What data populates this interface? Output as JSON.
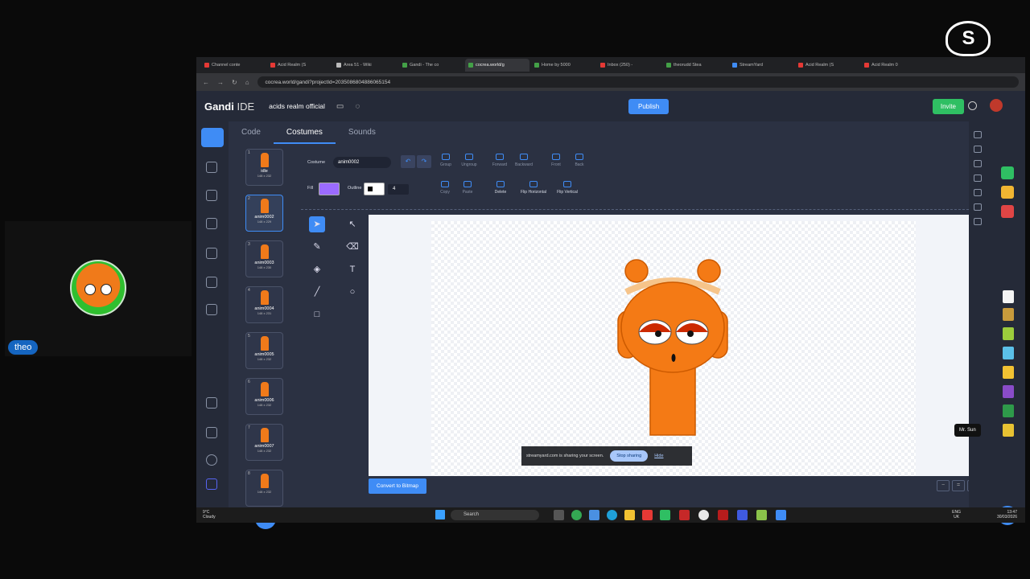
{
  "participant": {
    "name": "theo"
  },
  "brand": {
    "logo": "S",
    "name": "streamyard"
  },
  "browser": {
    "tabs": [
      {
        "title": "Channel conte",
        "color": "#e53935"
      },
      {
        "title": "Acid Realm (S",
        "color": "#e53935"
      },
      {
        "title": "Area 51 - Wiki",
        "color": "#bbbbbb"
      },
      {
        "title": "Gandi - The co",
        "color": "#43a047"
      },
      {
        "title": "cocrea.world/g",
        "color": "#43a047"
      },
      {
        "title": "Home by 5000",
        "color": "#43a047"
      },
      {
        "title": "Inbox (250) -",
        "color": "#e53935"
      },
      {
        "title": "theorudd Stea",
        "color": "#43a047"
      },
      {
        "title": "StreamYard",
        "color": "#3f8cf5"
      },
      {
        "title": "Acid Realm (S",
        "color": "#e53935"
      },
      {
        "title": "Acid Realm 0",
        "color": "#e53935"
      }
    ],
    "url": "cocrea.world/gandi?projectId=2035086804886065154"
  },
  "ide": {
    "logo": "Gandi",
    "logo_suffix": "IDE",
    "project_name": "acids realm official",
    "publish": "Publish",
    "invite": "Invite",
    "tabs": [
      {
        "label": "Code",
        "active": false
      },
      {
        "label": "Costumes",
        "active": true
      },
      {
        "label": "Sounds",
        "active": false
      }
    ],
    "costumes": [
      {
        "num": "1",
        "name": "idle",
        "size": "148 x 232"
      },
      {
        "num": "2",
        "name": "anim0002",
        "size": "148 x 229"
      },
      {
        "num": "3",
        "name": "anim0003",
        "size": "148 x 230"
      },
      {
        "num": "4",
        "name": "anim0004",
        "size": "148 x 231"
      },
      {
        "num": "5",
        "name": "anim0005",
        "size": "148 x 232"
      },
      {
        "num": "6",
        "name": "anim0006",
        "size": "148 x 232"
      },
      {
        "num": "7",
        "name": "anim0007",
        "size": "148 x 232"
      },
      {
        "num": "8",
        "name": "",
        "size": "148 x 232"
      }
    ],
    "paint": {
      "costume_label": "Costume",
      "costume_name": "anim0002",
      "fill_label": "Fill",
      "fill_color": "#9b6bff",
      "outline_label": "Outline",
      "outline_width": "4",
      "buttons_row1": [
        "Group",
        "Ungroup",
        "Forward",
        "Backward",
        "Front",
        "Back"
      ],
      "buttons_row2": [
        "Copy",
        "Paste",
        "Delete",
        "Flip Horizontal",
        "Flip Vertical"
      ],
      "convert": "Convert to Bitmap"
    },
    "share_bar": {
      "message": "streamyard.com is sharing your screen.",
      "stop": "Stop sharing",
      "hide": "Hide"
    },
    "tooltip": "Mr. Sun"
  },
  "taskbar": {
    "temp": "9°C",
    "weather": "Cloudy",
    "search": "Search",
    "lang1": "ENG",
    "lang2": "UK",
    "time": "13:47",
    "date": "30/03/2026"
  }
}
